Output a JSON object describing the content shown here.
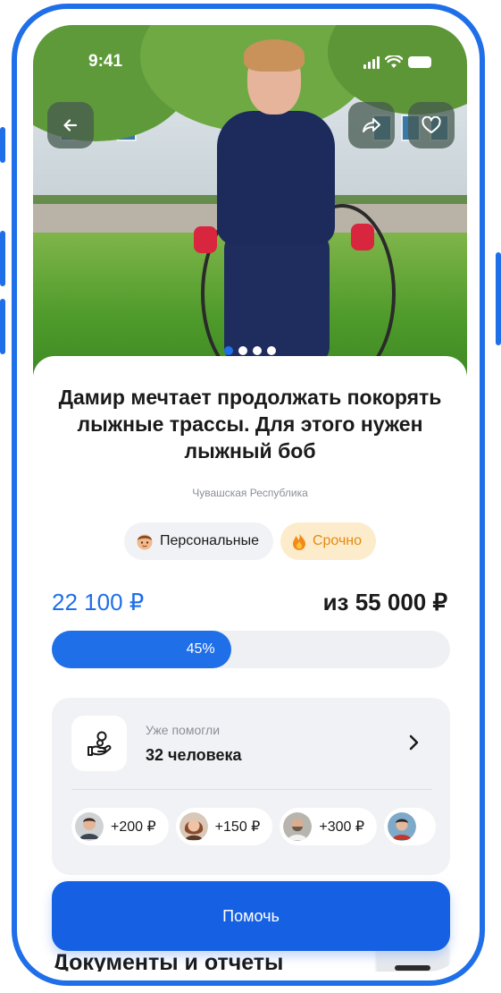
{
  "status_bar": {
    "time": "9:41"
  },
  "photo": {
    "slides_total": 4,
    "active_slide": 1
  },
  "fundraiser": {
    "title": "Дамир мечтает продолжать покорять лыжные трассы. Для этого нужен лыжный боб",
    "region": "Чувашская Республика",
    "tags": [
      {
        "label": "Персональные",
        "icon": "boy-face-emoji"
      },
      {
        "label": "Срочно",
        "icon": "fire-emoji"
      }
    ],
    "raised": "22 100 ₽",
    "goal": "из 55 000 ₽",
    "progress_label": "45%",
    "progress_fraction": 0.45
  },
  "helpers": {
    "label": "Уже помогли",
    "count": "32 человека",
    "donations": [
      {
        "amount": "+200 ₽"
      },
      {
        "amount": "+150 ₽"
      },
      {
        "amount": "+300 ₽"
      },
      {
        "amount": ""
      }
    ]
  },
  "actions": {
    "help_label": "Помочь"
  },
  "documents": {
    "title": "Документы и отчеты"
  },
  "colors": {
    "accent": "#1f6fe8",
    "button": "#1661e3",
    "urgent_bg": "#fdeccb",
    "urgent_text": "#e38a12"
  }
}
